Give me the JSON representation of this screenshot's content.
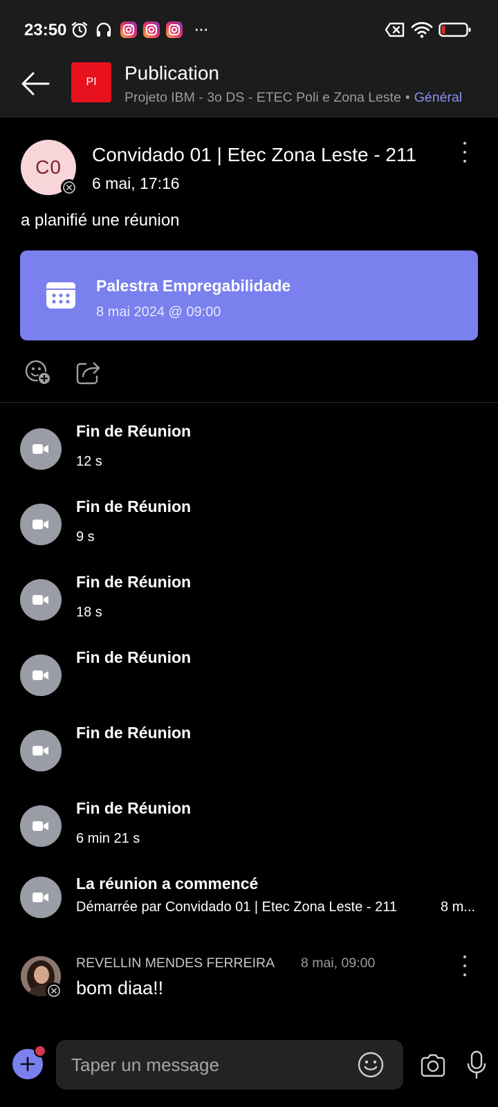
{
  "status_bar": {
    "time": "23:50",
    "icons": [
      "alarm-icon",
      "headphones-icon",
      "instagram-icon",
      "instagram-icon",
      "instagram-icon",
      "more-notifications-icon",
      "no-sim-icon",
      "wifi-icon",
      "battery-low-icon"
    ],
    "more": "···"
  },
  "header": {
    "title": "Publication",
    "team_initials": "PI",
    "team_name": "Projeto IBM - 3o DS - ETEC Poli e Zona Leste",
    "separator": "•",
    "channel": "Général"
  },
  "post": {
    "avatar_initials": "C0",
    "author": "Convidado 01 | Etec Zona Leste - 211",
    "time": "6 mai, 17:16",
    "text": "a planifié une réunion",
    "meeting": {
      "title": "Palestra Empregabilidade",
      "datetime": "8 mai 2024 @ 09:00"
    }
  },
  "events": [
    {
      "title": "Fin de Réunion",
      "subtitle": "12 s"
    },
    {
      "title": "Fin de Réunion",
      "subtitle": "9 s"
    },
    {
      "title": "Fin de Réunion",
      "subtitle": "18 s"
    },
    {
      "title": "Fin de Réunion",
      "subtitle": ""
    },
    {
      "title": "Fin de Réunion",
      "subtitle": ""
    },
    {
      "title": "Fin de Réunion",
      "subtitle": "6 min 21 s"
    },
    {
      "title": "La réunion a commencé",
      "subtitle": "Démarrée par Convidado 01 | Etec Zona Leste - 211",
      "trailing": "8 m..."
    }
  ],
  "reply": {
    "author": "REVELLIN MENDES FERREIRA",
    "time": "8 mai, 09:00",
    "text": "bom diaa!!"
  },
  "composer": {
    "placeholder": "Taper un message"
  },
  "colors": {
    "accent": "#7a80ee",
    "team_icon": "#e8121e",
    "channel_link": "#8b8ff4",
    "background": "#000000",
    "bar": "#1c1c1c"
  }
}
